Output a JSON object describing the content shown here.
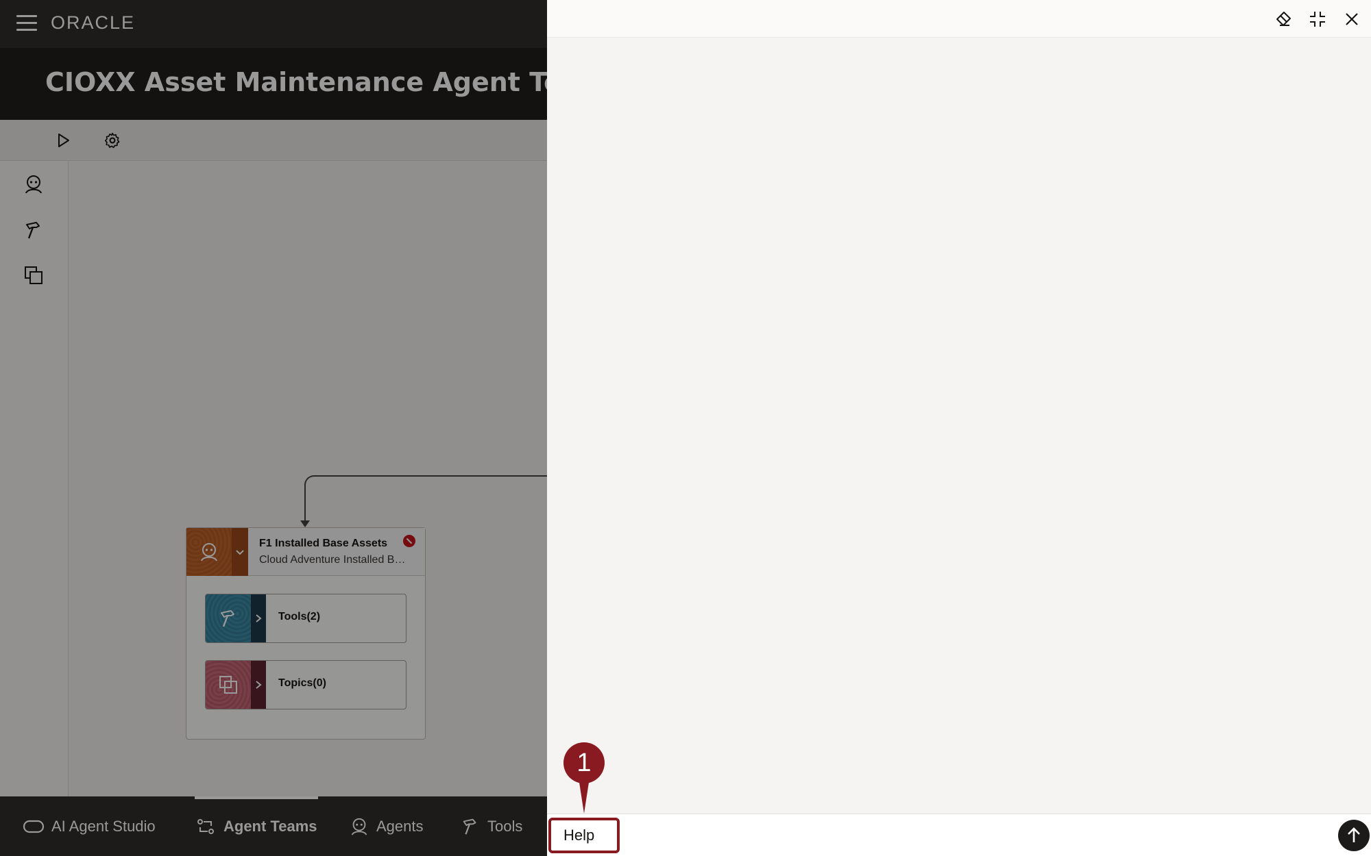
{
  "header": {
    "logo": "ORACLE",
    "title": "CIOXX Asset Maintenance Agent Team"
  },
  "canvas": {
    "agent": {
      "name": "F1 Installed Base Assets",
      "description": "Cloud Adventure Installed Base Assets"
    },
    "tools_label": "Tools(2)",
    "topics_label": "Topics(0)"
  },
  "bottom_nav": {
    "items": [
      {
        "label": "AI Agent Studio",
        "icon": "studio-icon"
      },
      {
        "label": "Agent Teams",
        "icon": "agent-teams-icon",
        "active": true
      },
      {
        "label": "Agents",
        "icon": "agent-icon"
      },
      {
        "label": "Tools",
        "icon": "hammer-icon"
      }
    ]
  },
  "help_panel": {
    "help_label": "Help"
  },
  "callout": {
    "number": "1"
  },
  "colors": {
    "brand_dark": "#312d2a",
    "callout_red": "#8a1a22",
    "agent_orange": "#b65a24",
    "tools_teal": "#357e97",
    "topics_rose": "#b85c6c"
  }
}
